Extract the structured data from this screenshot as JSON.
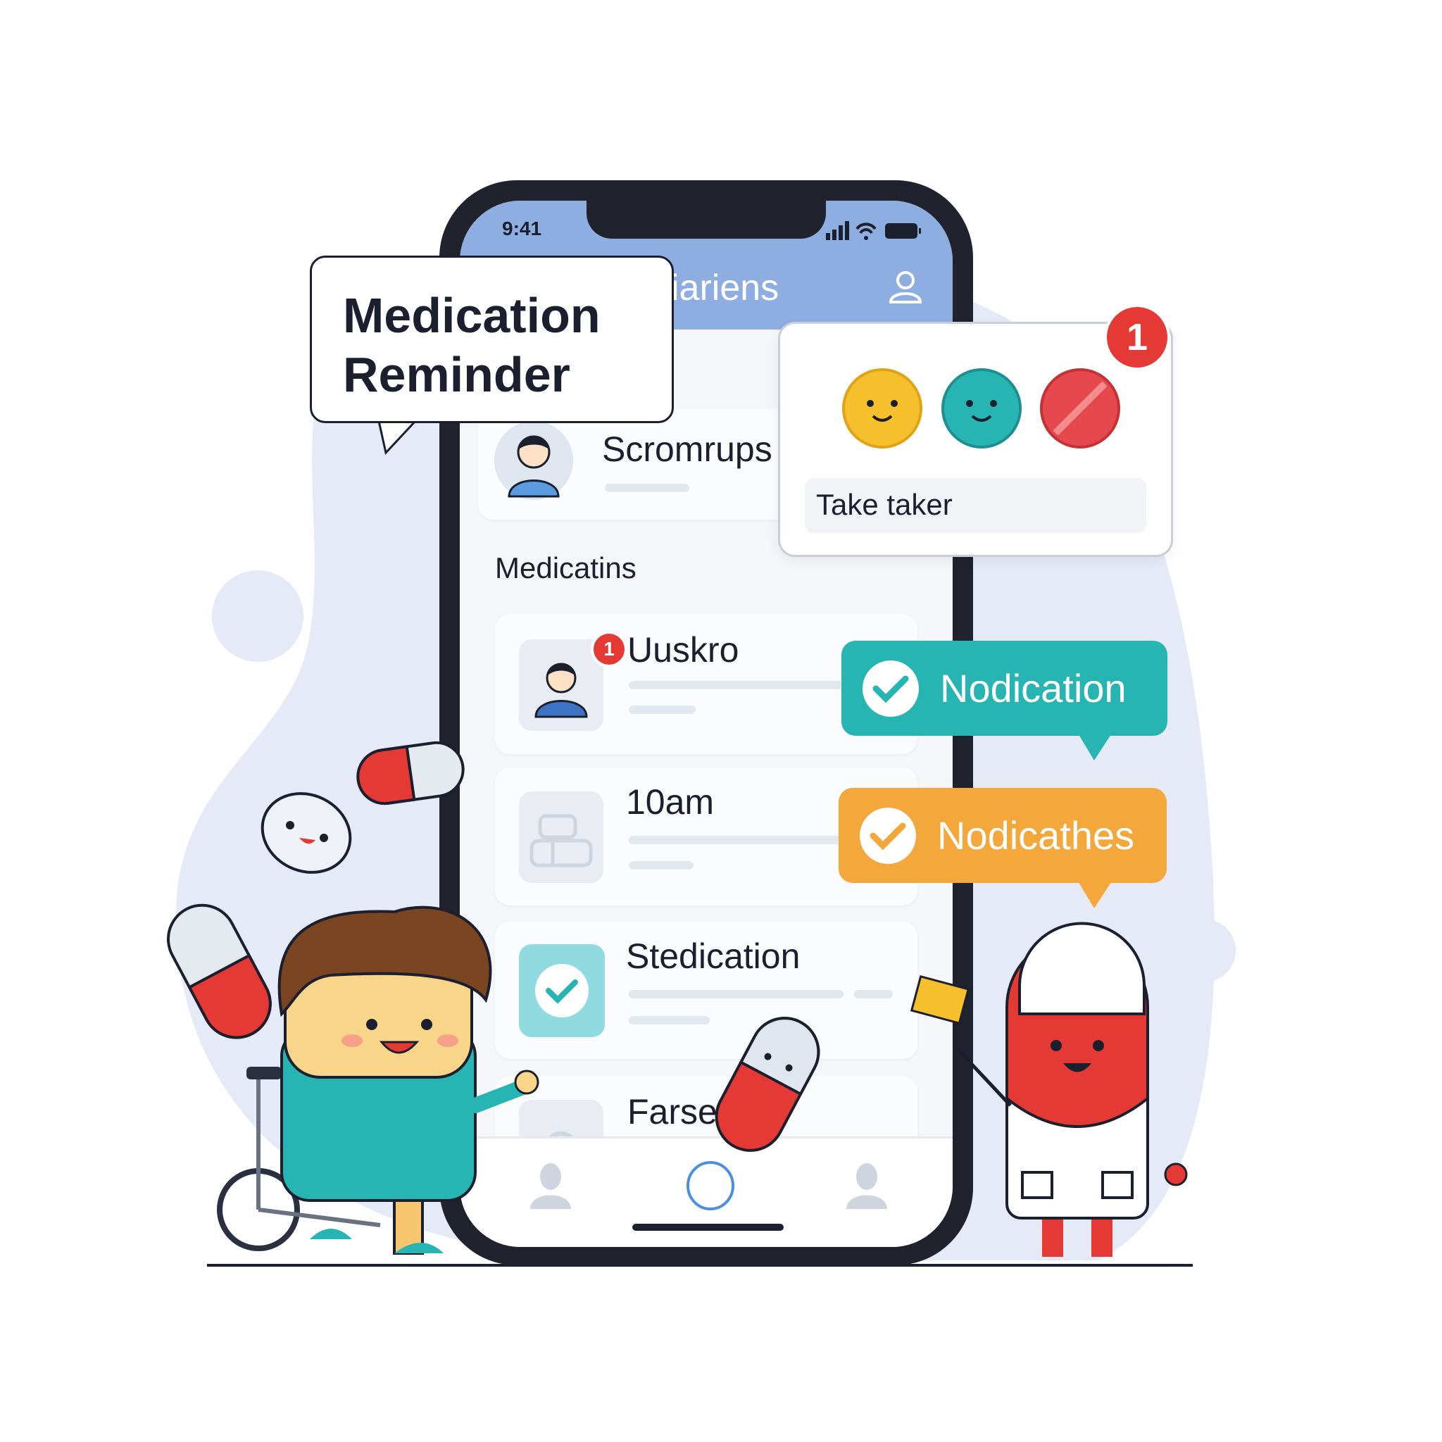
{
  "status_bar": {
    "time": "9:41"
  },
  "header": {
    "title": "iariens",
    "profile_icon": "user-outline-icon"
  },
  "callout": {
    "line1": "Medication",
    "line2": "Reminder"
  },
  "patient": {
    "name": "Scromrups"
  },
  "section": {
    "title": "Medicatins"
  },
  "medications": [
    {
      "title": "Uuskro",
      "badge": "1",
      "icon": "user-avatar-icon"
    },
    {
      "title": "10am",
      "icon": "pill-organizer-icon"
    },
    {
      "title": "Stedication",
      "icon": "checkmark-icon",
      "checked": true
    },
    {
      "title": "Farse",
      "icon": "placeholder-icon"
    }
  ],
  "popup": {
    "badge": "1",
    "field_value": "Take taker",
    "faces": [
      "happy-yellow",
      "happy-teal",
      "blocked-red"
    ]
  },
  "tags": [
    {
      "label": "Nodication",
      "color": "#27b5b3"
    },
    {
      "label": "Nodicathes",
      "color": "#f4a73a"
    }
  ],
  "nav": {
    "items": [
      "person-icon",
      "home-circle-icon",
      "person-icon"
    ]
  },
  "colors": {
    "header": "#8eaee2",
    "teal": "#27b5b3",
    "orange": "#f4a73a",
    "red": "#e53935",
    "blob": "#e6eaf6"
  }
}
